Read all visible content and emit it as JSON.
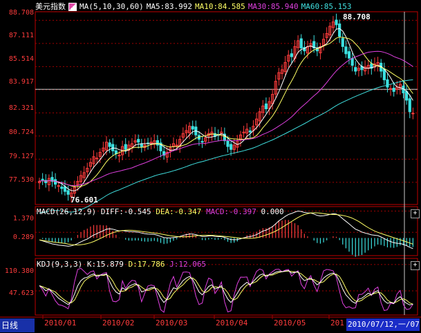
{
  "colors": {
    "up": "#ff3c3c",
    "down": "#3ce0e0",
    "ma5": "#ffffff",
    "ma10": "#ffff66",
    "ma30": "#e040e0",
    "ma60": "#40e0e0",
    "grid": "#a00000",
    "axis_text": "#ff3c3c",
    "diff": "#ffffff",
    "dea": "#ffff66",
    "macd_hist_up": "#ff3c3c",
    "macd_hist_down": "#3ce0e0",
    "kdj_k": "#ffffff",
    "kdj_d": "#ffff66",
    "kdj_j": "#e040e0"
  },
  "main_panel": {
    "title": "美元指数",
    "legend_icon": "ma-legend-icon",
    "ma_params": "MA(5,10,30,60)",
    "ma5": "MA5:83.992",
    "ma10": "MA10:84.585",
    "ma30": "MA30:85.940",
    "ma60": "MA60:85.153",
    "y_ticks": [
      "88.708",
      "87.111",
      "85.514",
      "83.917",
      "82.321",
      "80.724",
      "79.127",
      "77.530"
    ],
    "high_label": "88.708",
    "low_label": "76.601"
  },
  "macd_panel": {
    "params": "MACD(26,12,9)",
    "diff": "DIFF:-0.545",
    "dea": "DEA:-0.347",
    "macd": "MACD:-0.397",
    "extra": "0.000",
    "y_ticks": [
      "1.370",
      "0.289"
    ]
  },
  "kdj_panel": {
    "params": "KDJ(9,3,3)",
    "k": "K:15.879",
    "d": "D:17.786",
    "j": "J:12.065",
    "y_ticks": [
      "110.380",
      "47.623"
    ]
  },
  "x_axis": {
    "ticks": [
      "2010/01",
      "2010/02",
      "2010/03",
      "2010/04",
      "2010/05",
      "201"
    ]
  },
  "period_label": "日线",
  "cursor_date": "2010/07/12,一/07",
  "chart_data": {
    "type": "candlestick",
    "title": "美元指数",
    "ylim": [
      76.0,
      89.3
    ],
    "series": [
      {
        "name": "MA5",
        "value": 83.992
      },
      {
        "name": "MA10",
        "value": 84.585
      },
      {
        "name": "MA30",
        "value": 85.94
      },
      {
        "name": "MA60",
        "value": 85.153
      }
    ],
    "high": 88.708,
    "low": 76.601,
    "closes": [
      77.6,
      77.7,
      77.5,
      77.8,
      77.6,
      77.4,
      77.3,
      77.1,
      76.9,
      76.7,
      76.8,
      77.2,
      77.6,
      78.0,
      78.2,
      78.5,
      78.9,
      79.3,
      79.2,
      79.6,
      79.9,
      80.3,
      80.0,
      79.7,
      79.5,
      79.4,
      80.0,
      79.8,
      80.1,
      80.2,
      80.4,
      80.3,
      80.0,
      80.1,
      80.2,
      80.3,
      80.4,
      80.1,
      79.7,
      79.4,
      79.6,
      79.9,
      80.2,
      80.1,
      80.5,
      80.9,
      81.1,
      81.4,
      81.2,
      80.8,
      80.5,
      80.3,
      80.6,
      80.9,
      81.0,
      80.7,
      80.8,
      81.0,
      80.4,
      80.0,
      79.8,
      80.1,
      80.4,
      80.8,
      81.0,
      81.2,
      81.0,
      81.4,
      81.9,
      82.4,
      82.8,
      82.6,
      83.1,
      83.6,
      84.5,
      85.1,
      85.3,
      85.8,
      86.3,
      86.2,
      86.9,
      87.3,
      86.8,
      86.6,
      86.9,
      87.1,
      86.8,
      86.6,
      86.9,
      87.4,
      87.8,
      88.3,
      88.6,
      88.4,
      87.6,
      86.9,
      86.4,
      86.1,
      85.6,
      85.2,
      85.4,
      85.3,
      85.5,
      85.6,
      85.4,
      85.7,
      85.8,
      85.2,
      84.6,
      84.1,
      84.0,
      83.8,
      84.1,
      84.3,
      83.7,
      83.2,
      82.4,
      82.3
    ],
    "macd_diff": [
      -0.1,
      -0.15,
      -0.2,
      -0.25,
      -0.3,
      -0.33,
      -0.36,
      -0.38,
      -0.4,
      -0.42,
      -0.4,
      -0.35,
      -0.28,
      -0.2,
      -0.12,
      -0.05,
      0.05,
      0.15,
      0.22,
      0.3,
      0.37,
      0.45,
      0.47,
      0.45,
      0.4,
      0.36,
      0.38,
      0.35,
      0.33,
      0.32,
      0.31,
      0.29,
      0.25,
      0.22,
      0.2,
      0.19,
      0.18,
      0.14,
      0.08,
      0.02,
      0.0,
      0.0,
      0.02,
      0.04,
      0.08,
      0.13,
      0.17,
      0.2,
      0.2,
      0.17,
      0.12,
      0.08,
      0.08,
      0.1,
      0.11,
      0.08,
      0.07,
      0.07,
      0.03,
      -0.03,
      -0.08,
      -0.09,
      -0.08,
      -0.04,
      0.0,
      0.05,
      0.07,
      0.11,
      0.17,
      0.26,
      0.35,
      0.4,
      0.48,
      0.58,
      0.72,
      0.87,
      0.98,
      1.1,
      1.2,
      1.25,
      1.32,
      1.37,
      1.35,
      1.3,
      1.28,
      1.27,
      1.22,
      1.15,
      1.12,
      1.13,
      1.16,
      1.2,
      1.24,
      1.22,
      1.12,
      0.98,
      0.85,
      0.72,
      0.58,
      0.45,
      0.38,
      0.3,
      0.25,
      0.21,
      0.16,
      0.14,
      0.12,
      0.05,
      -0.03,
      -0.12,
      -0.18,
      -0.24,
      -0.27,
      -0.28,
      -0.33,
      -0.39,
      -0.48,
      -0.545
    ],
    "kdj_k": [
      60,
      55,
      48,
      52,
      45,
      38,
      30,
      25,
      20,
      15,
      22,
      40,
      60,
      72,
      78,
      80,
      85,
      88,
      82,
      85,
      86,
      88,
      70,
      55,
      45,
      40,
      55,
      50,
      58,
      62,
      65,
      60,
      45,
      48,
      52,
      55,
      56,
      45,
      30,
      20,
      28,
      42,
      55,
      52,
      62,
      72,
      78,
      82,
      75,
      60,
      45,
      38,
      48,
      58,
      62,
      52,
      55,
      60,
      42,
      28,
      20,
      30,
      42,
      55,
      62,
      68,
      62,
      70,
      78,
      85,
      88,
      82,
      86,
      88,
      92,
      94,
      93,
      95,
      96,
      90,
      92,
      93,
      80,
      72,
      75,
      78,
      70,
      62,
      68,
      78,
      84,
      88,
      90,
      85,
      70,
      52,
      38,
      30,
      22,
      18,
      28,
      30,
      36,
      42,
      38,
      45,
      48,
      35,
      24,
      18,
      20,
      18,
      28,
      34,
      24,
      18,
      14,
      15.879
    ]
  }
}
